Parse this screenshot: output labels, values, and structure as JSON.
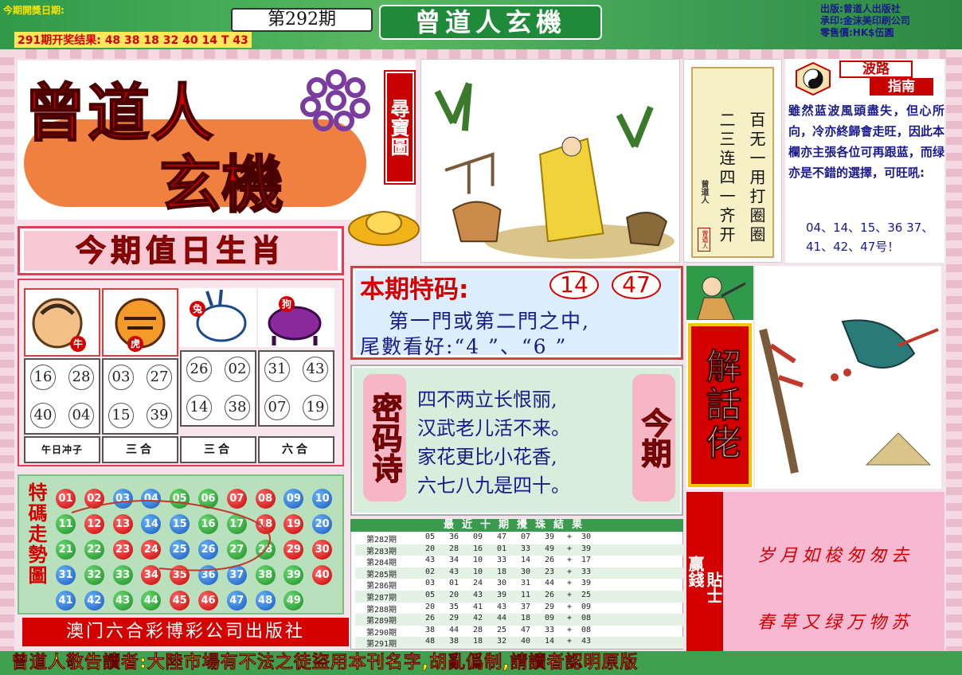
{
  "header": {
    "date_label": "今期開獎日期:",
    "last_result": "291期开奖结果: 48 38 18 32 40 14 T 43",
    "issue": "第292期",
    "brand": "曾道人玄機",
    "publisher_info": [
      "出版:曾道人出版社",
      "承印:金沫美印刷公司",
      "零售價:HK$伍圓"
    ]
  },
  "logo": {
    "title_top": "曾道人",
    "title_bottom": "玄機",
    "treasure_map": "尋寶圖"
  },
  "vertical_poem": {
    "col_right": "百无一用打圈圈",
    "col_left": "二三连四一齐开",
    "signature": "曾道人",
    "seal": "曾道人"
  },
  "wave_guide": {
    "title1": "波路",
    "title2": "指南",
    "text": "雖然蓝波風頭盡失，但心所向，冷亦終歸會走旺，因此本欄亦主張各位可再跟蓝，而绿亦是不錯的選擇，可旺吼:",
    "numbers": "04、14、15、36 37、41、42、47号！"
  },
  "zodiac": {
    "title": "今期值日生肖",
    "animals": [
      {
        "name": "牛",
        "icon": "ox-icon",
        "numbers": [
          "16",
          "28",
          "40",
          "04"
        ],
        "label": "午日冲子"
      },
      {
        "name": "虎",
        "icon": "tiger-icon",
        "numbers": [
          "03",
          "27",
          "15",
          "39"
        ],
        "label": "三合"
      },
      {
        "name": "兔",
        "icon": "rabbit-icon",
        "numbers": [
          "26",
          "02",
          "14",
          "38"
        ],
        "label": "三合"
      },
      {
        "name": "狗",
        "icon": "dog-icon",
        "numbers": [
          "31",
          "43",
          "07",
          "19"
        ],
        "label": "六合"
      }
    ]
  },
  "special": {
    "label": "本期特码:",
    "numbers": [
      "14",
      "47"
    ],
    "line1": "第一門或第二門之中,",
    "line2": "尾數看好:“4 ”、“6 ”"
  },
  "code_poem": {
    "left_title": "密码诗",
    "right_title": "今期",
    "lines": [
      "四不两立长恨丽,",
      "汉武老儿活不来。",
      "家花更比小花香,",
      "六七八九是四十。"
    ]
  },
  "history": {
    "title": "最近十期攪珠結果",
    "rows": [
      {
        "issue": "第282期",
        "nums": [
          "05",
          "36",
          "09",
          "47",
          "07",
          "39"
        ],
        "special": "30"
      },
      {
        "issue": "第283期",
        "nums": [
          "20",
          "28",
          "16",
          "01",
          "33",
          "49"
        ],
        "special": "39"
      },
      {
        "issue": "第284期",
        "nums": [
          "43",
          "34",
          "10",
          "33",
          "14",
          "26"
        ],
        "special": "17"
      },
      {
        "issue": "第285期",
        "nums": [
          "02",
          "43",
          "10",
          "18",
          "30",
          "23"
        ],
        "special": "33"
      },
      {
        "issue": "第286期",
        "nums": [
          "03",
          "01",
          "24",
          "30",
          "31",
          "44"
        ],
        "special": "39"
      },
      {
        "issue": "第287期",
        "nums": [
          "05",
          "20",
          "43",
          "39",
          "11",
          "26"
        ],
        "special": "25"
      },
      {
        "issue": "第288期",
        "nums": [
          "20",
          "35",
          "41",
          "43",
          "37",
          "29"
        ],
        "special": "09"
      },
      {
        "issue": "第289期",
        "nums": [
          "26",
          "29",
          "42",
          "44",
          "18",
          "09"
        ],
        "special": "08"
      },
      {
        "issue": "第290期",
        "nums": [
          "38",
          "44",
          "28",
          "25",
          "47",
          "33"
        ],
        "special": "08"
      },
      {
        "issue": "第291期",
        "nums": [
          "48",
          "38",
          "18",
          "32",
          "40",
          "14"
        ],
        "special": "43"
      }
    ],
    "plus": "+"
  },
  "trend": {
    "label": "特碼走勢圖",
    "balls": [
      [
        "01",
        "red"
      ],
      [
        "02",
        "red"
      ],
      [
        "03",
        "blue"
      ],
      [
        "04",
        "blue"
      ],
      [
        "05",
        "green"
      ],
      [
        "06",
        "green"
      ],
      [
        "07",
        "red"
      ],
      [
        "08",
        "red"
      ],
      [
        "09",
        "blue"
      ],
      [
        "10",
        "blue"
      ],
      [
        "11",
        "green"
      ],
      [
        "12",
        "red"
      ],
      [
        "13",
        "red"
      ],
      [
        "14",
        "blue"
      ],
      [
        "15",
        "blue"
      ],
      [
        "16",
        "green"
      ],
      [
        "17",
        "green"
      ],
      [
        "18",
        "red"
      ],
      [
        "19",
        "red"
      ],
      [
        "20",
        "blue"
      ],
      [
        "21",
        "green"
      ],
      [
        "22",
        "green"
      ],
      [
        "23",
        "red"
      ],
      [
        "24",
        "red"
      ],
      [
        "25",
        "blue"
      ],
      [
        "26",
        "blue"
      ],
      [
        "27",
        "green"
      ],
      [
        "28",
        "green"
      ],
      [
        "29",
        "red"
      ],
      [
        "30",
        "red"
      ],
      [
        "31",
        "blue"
      ],
      [
        "32",
        "green"
      ],
      [
        "33",
        "green"
      ],
      [
        "34",
        "red"
      ],
      [
        "35",
        "red"
      ],
      [
        "36",
        "blue"
      ],
      [
        "37",
        "blue"
      ],
      [
        "38",
        "green"
      ],
      [
        "39",
        "green"
      ],
      [
        "40",
        "red"
      ],
      [
        "41",
        "blue"
      ],
      [
        "42",
        "blue"
      ],
      [
        "43",
        "green"
      ],
      [
        "44",
        "green"
      ],
      [
        "45",
        "red"
      ],
      [
        "46",
        "red"
      ],
      [
        "47",
        "blue"
      ],
      [
        "48",
        "blue"
      ],
      [
        "49",
        "green"
      ]
    ]
  },
  "publisher": "澳门六合彩博彩公司出版社",
  "riddle": {
    "title": "解話佬"
  },
  "tips": {
    "left": "赢錢",
    "mid": "貼士",
    "line1": "岁月如梭匆匆去",
    "line2": "春草又绿万物苏"
  },
  "footer": "曾道人敬告讀者:大陸市場有不法之徒盜用本刊名字,胡亂僞制,請讀者認明原版"
}
